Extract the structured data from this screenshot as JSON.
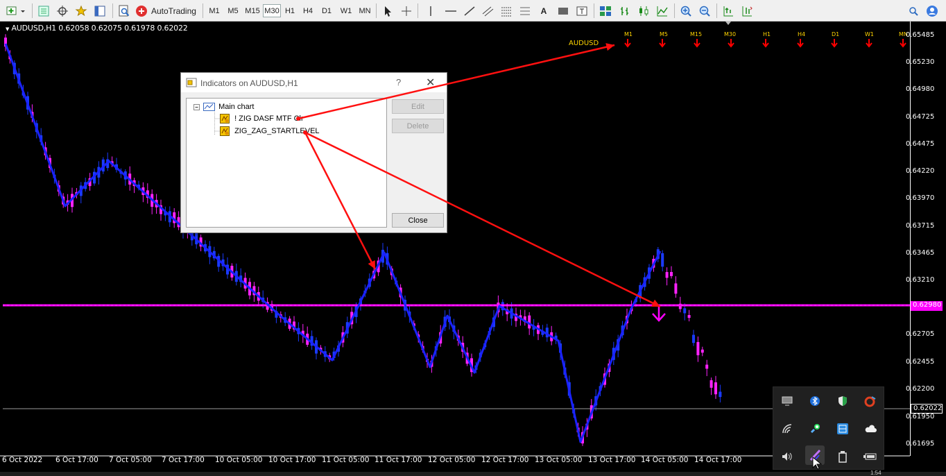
{
  "toolbar": {
    "autotrading_label": "AutoTrading",
    "timeframes": [
      "M1",
      "M5",
      "M15",
      "M30",
      "H1",
      "H4",
      "D1",
      "W1",
      "MN"
    ],
    "active_timeframe": "M30"
  },
  "chart": {
    "title": "AUDUSD,H1  0.62058 0.62075 0.61978 0.62022",
    "symbol_label": "AUDUSD",
    "mtf_labels": [
      "M1",
      "M5",
      "M15",
      "M30",
      "H1",
      "H4",
      "D1",
      "W1",
      "MN"
    ],
    "price_labels": [
      "0.65485",
      "0.65230",
      "0.64980",
      "0.64725",
      "0.64475",
      "0.64220",
      "0.63970",
      "0.63715",
      "0.63465",
      "0.63210",
      "0.62705",
      "0.62455",
      "0.62200",
      "0.61950",
      "0.61695"
    ],
    "level_price": "0.62980",
    "current_price": "0.62022",
    "time_labels": [
      "6 Oct 2022",
      "6 Oct 17:00",
      "7 Oct 05:00",
      "7 Oct 17:00",
      "10 Oct 05:00",
      "10 Oct 17:00",
      "11 Oct 05:00",
      "11 Oct 17:00",
      "12 Oct 05:00",
      "12 Oct 17:00",
      "13 Oct 05:00",
      "13 Oct 17:00",
      "14 Oct 05:00",
      "14 Oct 17:00"
    ],
    "colors": {
      "zigzag": "#1a22ff",
      "level": "#ff00ff",
      "candle_up": "#ff22ff",
      "candle_down": "#1a3aff",
      "arrow": "#ff0000",
      "mtf": "#ffd400"
    }
  },
  "dialog": {
    "title": "Indicators on AUDUSD,H1",
    "help": "?",
    "close_glyph": "✕",
    "tree": {
      "root": "Main chart",
      "items": [
        "! ZIG DASF MTF Clr",
        "ZIG_ZAG_STARTLEVEL"
      ]
    },
    "buttons": {
      "edit": "Edit",
      "delete": "Delete",
      "close": "Close"
    }
  },
  "tray": {
    "icons": [
      "monitor-icon",
      "bluetooth-icon",
      "defender-icon",
      "ccleaner-icon",
      "wifi-icon",
      "rocket-icon",
      "network-app-icon",
      "onedrive-icon",
      "volume-icon",
      "pen-icon",
      "usb-icon",
      "battery-icon"
    ]
  },
  "clock": "1:54"
}
